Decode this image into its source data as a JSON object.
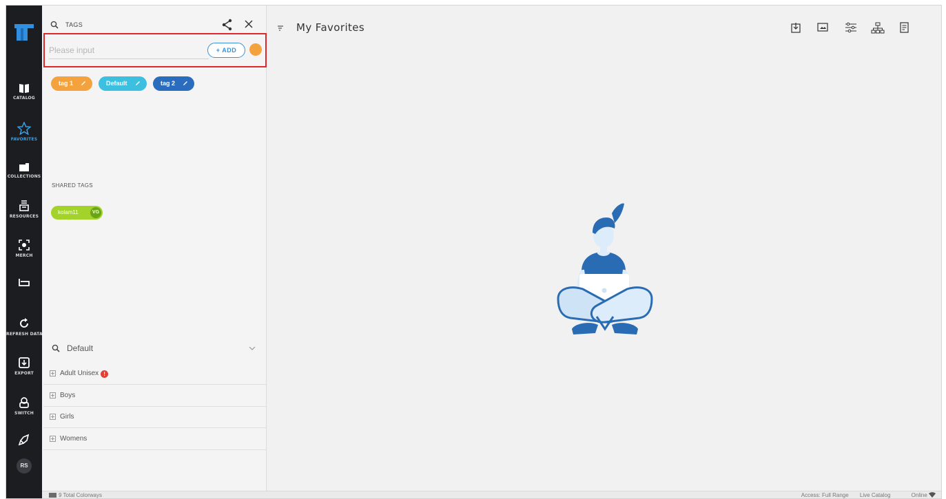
{
  "nav": {
    "items": [
      {
        "label": "CATALOG",
        "icon": "book-icon"
      },
      {
        "label": "FAVORITES",
        "icon": "star-icon"
      },
      {
        "label": "COLLECTIONS",
        "icon": "folder-icon"
      },
      {
        "label": "RESOURCES",
        "icon": "resources-icon"
      },
      {
        "label": "MERCH",
        "icon": "merch-icon"
      },
      {
        "label": "",
        "icon": "sofa-icon"
      },
      {
        "label": "REFRESH DATA",
        "icon": "refresh-icon"
      },
      {
        "label": "EXPORT",
        "icon": "export-icon"
      },
      {
        "label": "SWITCH",
        "icon": "switch-icon"
      },
      {
        "label": "",
        "icon": "rocket-icon"
      }
    ],
    "avatar": "RS",
    "accent": "#3aa0e6",
    "background": "#1b1d21"
  },
  "panel": {
    "title": "TAGS",
    "input_placeholder": "Please input",
    "input_value": "",
    "add_label": "+ ADD",
    "color_dot": "#f3a23e",
    "tags": [
      {
        "label": "tag 1",
        "color": "#f3a23e"
      },
      {
        "label": "Default",
        "color": "#3dbfe0"
      },
      {
        "label": "tag 2",
        "color": "#2a6cbd"
      }
    ],
    "shared_title": "SHARED TAGS",
    "shared_tag": {
      "label": "kolam11",
      "badge": "VG",
      "color": "#a3d32a"
    },
    "filter": "Default",
    "groups": [
      {
        "label": "Adult Unisex",
        "badge": "!"
      },
      {
        "label": "Boys"
      },
      {
        "label": "Girls"
      },
      {
        "label": "Womens"
      }
    ]
  },
  "main": {
    "title": "My Favorites",
    "tools": [
      "download-icon",
      "image-icon",
      "sliders-icon",
      "hierarchy-icon",
      "document-icon"
    ]
  },
  "status": {
    "colorways": "9 Total Colorways",
    "access": "Access: Full Range",
    "catalog": "Live Catalog",
    "connection": "Online"
  }
}
